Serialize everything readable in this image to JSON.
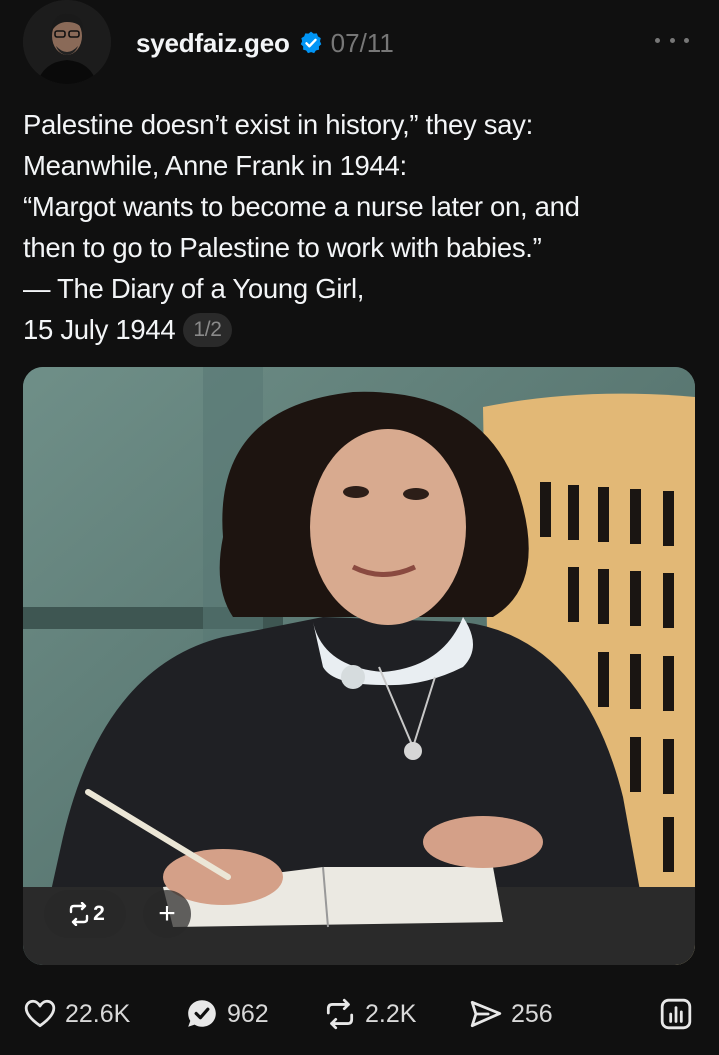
{
  "post": {
    "username": "syedfaiz.geo",
    "date": "07/11",
    "text_lines": [
      "Palestine doesn’t exist in history,” they say:",
      "Meanwhile, Anne Frank in 1944:",
      "“Margot wants to become a nurse later on, and",
      "then to go to Palestine to work with babies.”",
      "— The Diary of a Young Girl,",
      "15 July 1944"
    ],
    "pager": "1/2"
  },
  "media": {
    "repost_count": "2",
    "add_label": "+"
  },
  "actions": {
    "likes": "22.6K",
    "comments": "962",
    "reposts": "2.2K",
    "shares": "256"
  },
  "colors": {
    "background": "#101010",
    "verified": "#0095f6",
    "muted": "#777777"
  },
  "icons": [
    "more-icon",
    "verified-icon",
    "heart-icon",
    "comment-check-icon",
    "repost-icon",
    "share-icon",
    "insights-icon"
  ]
}
